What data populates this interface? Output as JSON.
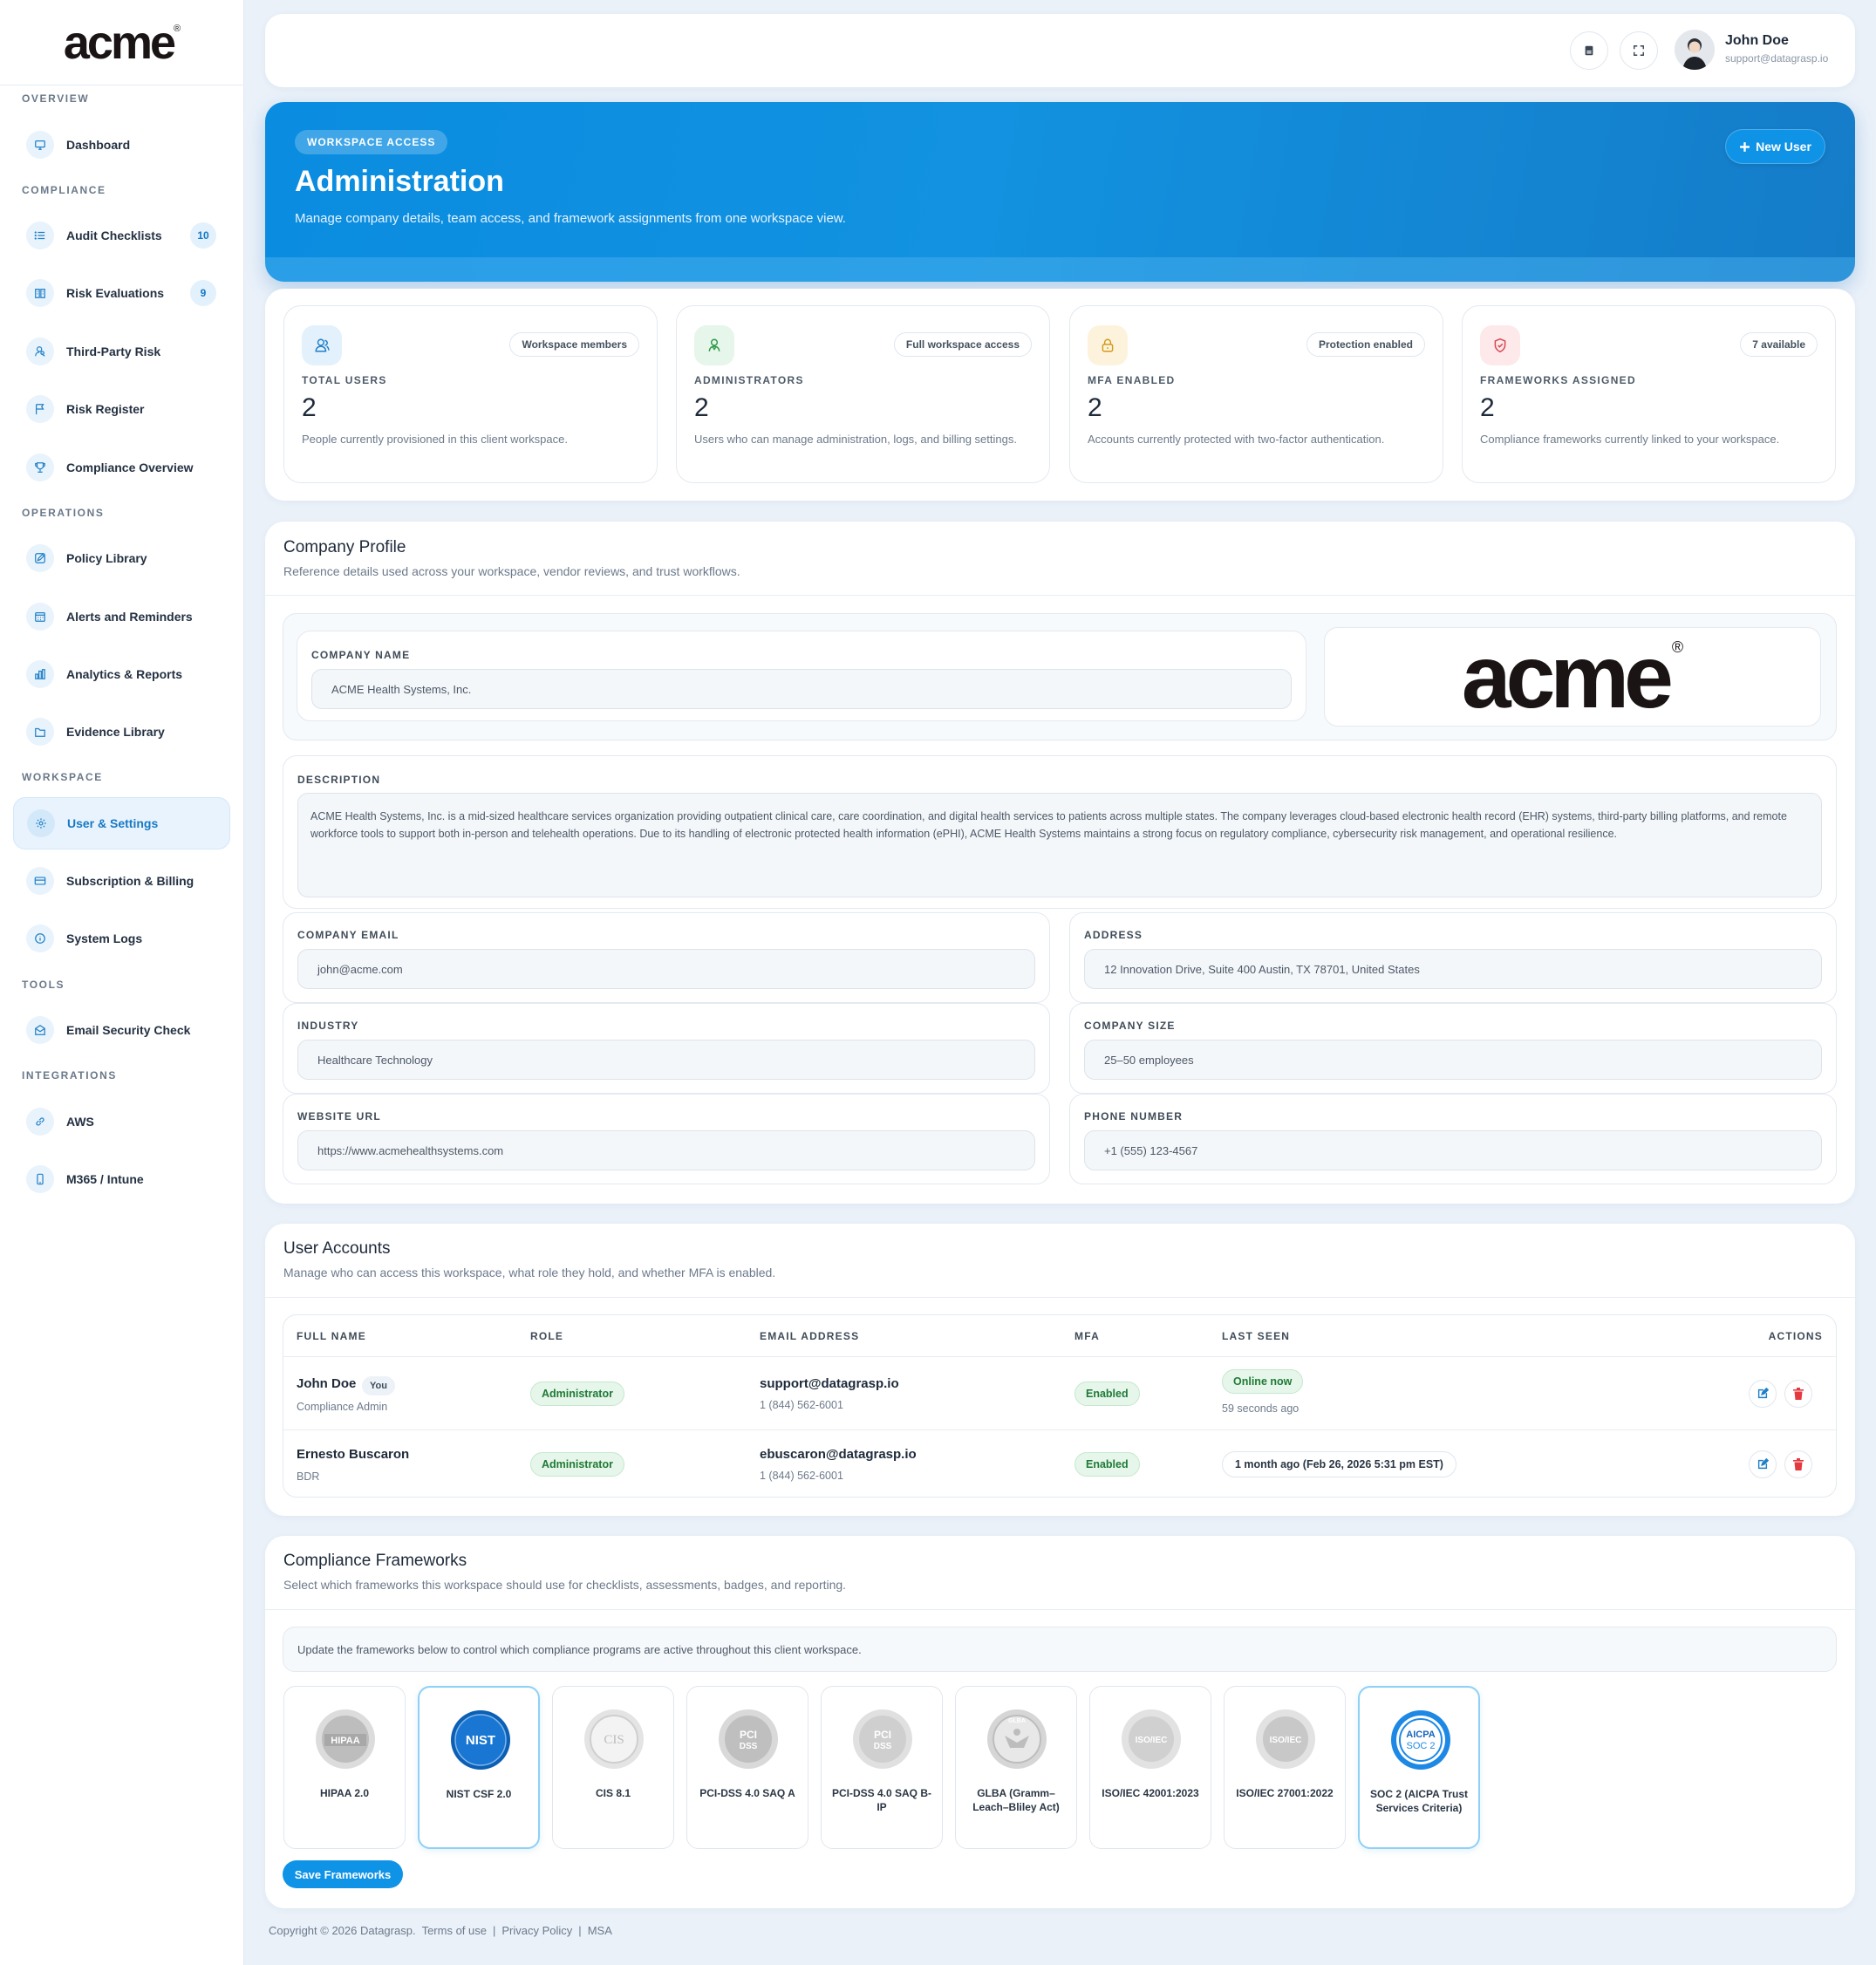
{
  "brand": {
    "logo_text": "acme",
    "registered_mark": "®"
  },
  "sidebar": {
    "sections": {
      "overview": "OVERVIEW",
      "compliance": "COMPLIANCE",
      "operations": "OPERATIONS",
      "workspace": "WORKSPACE",
      "tools": "TOOLS",
      "integrations": "INTEGRATIONS"
    },
    "items": [
      {
        "label": "Dashboard",
        "icon": "monitor-icon"
      },
      {
        "label": "Audit Checklists",
        "icon": "list-icon",
        "badge": "10"
      },
      {
        "label": "Risk Evaluations",
        "icon": "book-icon",
        "badge": "9"
      },
      {
        "label": "Third-Party Risk",
        "icon": "user-search-icon"
      },
      {
        "label": "Risk Register",
        "icon": "flag-icon"
      },
      {
        "label": "Compliance Overview",
        "icon": "trophy-icon"
      },
      {
        "label": "Policy Library",
        "icon": "edit-icon"
      },
      {
        "label": "Alerts and Reminders",
        "icon": "calendar-icon"
      },
      {
        "label": "Analytics & Reports",
        "icon": "bar-chart-icon"
      },
      {
        "label": "Evidence Library",
        "icon": "folder-icon"
      },
      {
        "label": "User & Settings",
        "icon": "gear-icon",
        "active": true
      },
      {
        "label": "Subscription & Billing",
        "icon": "credit-card-icon"
      },
      {
        "label": "System Logs",
        "icon": "info-icon"
      },
      {
        "label": "Email Security Check",
        "icon": "mail-shield-icon"
      },
      {
        "label": "AWS",
        "icon": "link-icon"
      },
      {
        "label": "M365 / Intune",
        "icon": "phone-icon"
      }
    ]
  },
  "topbar": {
    "user_name": "John Doe",
    "user_email": "support@datagrasp.io"
  },
  "hero": {
    "badge": "WORKSPACE ACCESS",
    "title": "Administration",
    "subtitle": "Manage company details, team access, and framework assignments from one workspace view.",
    "new_user_label": "New User"
  },
  "stats": [
    {
      "label": "TOTAL USERS",
      "value": "2",
      "pill": "Workspace members",
      "desc": "People currently provisioned in this client workspace.",
      "color": "#e3f1fc",
      "icon": "users-icon"
    },
    {
      "label": "ADMINISTRATORS",
      "value": "2",
      "pill": "Full workspace access",
      "desc": "Users who can manage administration, logs, and billing settings.",
      "color": "#e6f6ea",
      "icon": "admin-icon"
    },
    {
      "label": "MFA ENABLED",
      "value": "2",
      "pill": "Protection enabled",
      "desc": "Accounts currently protected with two-factor authentication.",
      "color": "#fdf3dc",
      "icon": "lock-icon"
    },
    {
      "label": "FRAMEWORKS ASSIGNED",
      "value": "2",
      "pill": "7 available",
      "desc": "Compliance frameworks currently linked to your workspace.",
      "color": "#fde8ea",
      "icon": "shield-icon"
    }
  ],
  "company": {
    "title": "Company Profile",
    "subtitle": "Reference details used across your workspace, vendor reviews, and trust workflows.",
    "fields": {
      "name": {
        "label": "COMPANY NAME",
        "value": "ACME Health Systems, Inc."
      },
      "description": {
        "label": "DESCRIPTION",
        "value": "ACME Health Systems, Inc. is a mid-sized healthcare services organization providing outpatient clinical care, care coordination, and digital health services to patients across multiple states. The company leverages cloud-based electronic health record (EHR) systems, third-party billing platforms, and remote workforce tools to support both in-person and telehealth operations. Due to its handling of electronic protected health information (ePHI), ACME Health Systems maintains a strong focus on regulatory compliance, cybersecurity risk management, and operational resilience."
      },
      "email": {
        "label": "COMPANY EMAIL",
        "value": "john@acme.com"
      },
      "address": {
        "label": "ADDRESS",
        "value": "12 Innovation Drive, Suite 400 Austin, TX 78701, United States"
      },
      "industry": {
        "label": "INDUSTRY",
        "value": "Healthcare Technology"
      },
      "size": {
        "label": "COMPANY SIZE",
        "value": "25–50 employees"
      },
      "website": {
        "label": "WEBSITE URL",
        "value": "https://www.acmehealthsystems.com"
      },
      "phone": {
        "label": "PHONE NUMBER",
        "value": "+1 (555) 123-4567"
      }
    }
  },
  "users": {
    "title": "User Accounts",
    "subtitle": "Manage who can access this workspace, what role they hold, and whether MFA is enabled.",
    "columns": [
      "FULL NAME",
      "ROLE",
      "EMAIL ADDRESS",
      "MFA",
      "LAST SEEN",
      "ACTIONS"
    ],
    "rows": [
      {
        "name": "John Doe",
        "you": "You",
        "title": "Compliance Admin",
        "role": "Administrator",
        "email": "support@datagrasp.io",
        "phone": "1 (844) 562-6001",
        "mfa": "Enabled",
        "seen": "Online now",
        "seen_sub": "59 seconds ago"
      },
      {
        "name": "Ernesto Buscaron",
        "title": "BDR",
        "role": "Administrator",
        "email": "ebuscaron@datagrasp.io",
        "phone": "1 (844) 562-6001",
        "mfa": "Enabled",
        "seen": "1 month ago (Feb 26, 2026 5:31 pm EST)"
      }
    ]
  },
  "frameworks": {
    "title": "Compliance Frameworks",
    "subtitle": "Select which frameworks this workspace should use for checklists, assessments, badges, and reporting.",
    "info": "Update the frameworks below to control which compliance programs are active throughout this client workspace.",
    "items": [
      {
        "label": "HIPAA 2.0",
        "badge": "HIPAA",
        "selected": false
      },
      {
        "label": "NIST CSF 2.0",
        "badge": "NIST",
        "selected": true
      },
      {
        "label": "CIS 8.1",
        "badge": "CIS",
        "selected": false
      },
      {
        "label": "PCI-DSS 4.0 SAQ A",
        "badge": "PCI DSS",
        "selected": false
      },
      {
        "label": "PCI-DSS 4.0 SAQ B-IP",
        "badge": "PCI DSS",
        "selected": false
      },
      {
        "label": "GLBA (Gramm–Leach–Bliley Act)",
        "badge": "GLBA",
        "selected": false
      },
      {
        "label": "ISO/IEC 42001:2023",
        "badge": "ISO/IEC",
        "selected": false
      },
      {
        "label": "ISO/IEC 27001:2022",
        "badge": "ISO/IEC",
        "selected": false
      },
      {
        "label": "SOC 2 (AICPA Trust Services Criteria)",
        "badge": "AICPA SOC 2",
        "selected": true
      }
    ],
    "save_label": "Save Frameworks"
  },
  "footer": {
    "copyright": "Copyright © 2026 Datagrasp.",
    "links": [
      "Terms of use",
      "Privacy Policy",
      "MSA"
    ],
    "sep": "|"
  }
}
